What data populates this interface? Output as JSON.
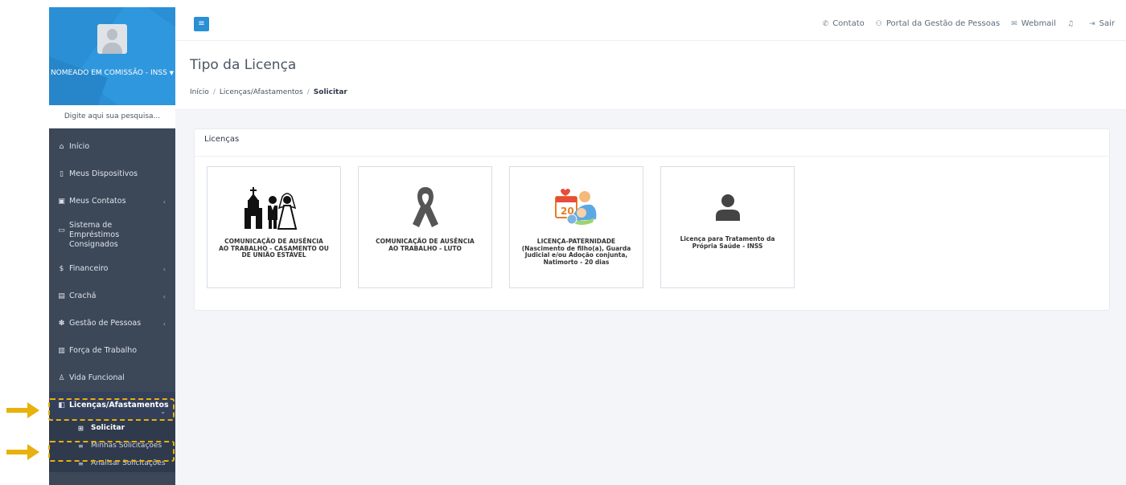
{
  "sidebar": {
    "profile_name": "NOMEADO EM COMISSÃO - INSS",
    "search_placeholder": "Digite aqui sua pesquisa...",
    "items": [
      {
        "label": "Início",
        "icon": "home-icon"
      },
      {
        "label": "Meus Dispositivos",
        "icon": "device-icon"
      },
      {
        "label": "Meus Contatos",
        "icon": "contacts-icon"
      },
      {
        "label": "Sistema de Empréstimos Consignados",
        "icon": "loan-icon"
      },
      {
        "label": "Financeiro",
        "icon": "dollar-icon"
      },
      {
        "label": "Crachá",
        "icon": "badge-icon"
      },
      {
        "label": "Gestão de Pessoas",
        "icon": "people-icon"
      },
      {
        "label": "Força de Trabalho",
        "icon": "workforce-icon"
      },
      {
        "label": "Vida Funcional",
        "icon": "user-icon"
      },
      {
        "label": "Licenças/Afastamentos",
        "icon": "leave-icon"
      }
    ],
    "subitems": [
      {
        "label": "Solicitar",
        "icon": "plus-square-icon"
      },
      {
        "label": "Minhas Solicitações",
        "icon": "list-icon"
      },
      {
        "label": "Analisar Solicitações",
        "icon": "list-icon"
      }
    ]
  },
  "topbar": {
    "links": [
      {
        "label": "Contato",
        "icon": "phone-icon"
      },
      {
        "label": "Portal da Gestão de Pessoas",
        "icon": "users-icon"
      },
      {
        "label": "Webmail",
        "icon": "envelope-icon"
      },
      {
        "label": "",
        "icon": "bell-icon"
      },
      {
        "label": "Sair",
        "icon": "logout-icon"
      }
    ]
  },
  "header": {
    "title": "Tipo da Licença",
    "breadcrumb": [
      "Início",
      "Licenças/Afastamentos",
      "Solicitar"
    ]
  },
  "panel": {
    "title": "Licenças",
    "cards": [
      {
        "label": "COMUNICAÇÃO DE AUSÊNCIA AO TRABALHO - CASAMENTO OU DE UNIÃO ESTÁVEL",
        "icon": "wedding-icon"
      },
      {
        "label": "COMUNICAÇÃO DE AUSÊNCIA AO TRABALHO - LUTO",
        "icon": "mourning-ribbon-icon"
      },
      {
        "label": "LICENÇA-PATERNIDADE (Nascimento de filho(a), Guarda Judicial e/ou Adoção conjunta, Natimorto - 20 dias",
        "icon": "paternity-calendar-icon"
      },
      {
        "label": "Licença para Tratamento da Própria Saúde - INSS",
        "icon": "person-icon"
      }
    ]
  },
  "colors": {
    "accent": "#2a8fd4",
    "sidebar_bg": "#3c4758",
    "highlight": "#e8b10b"
  }
}
